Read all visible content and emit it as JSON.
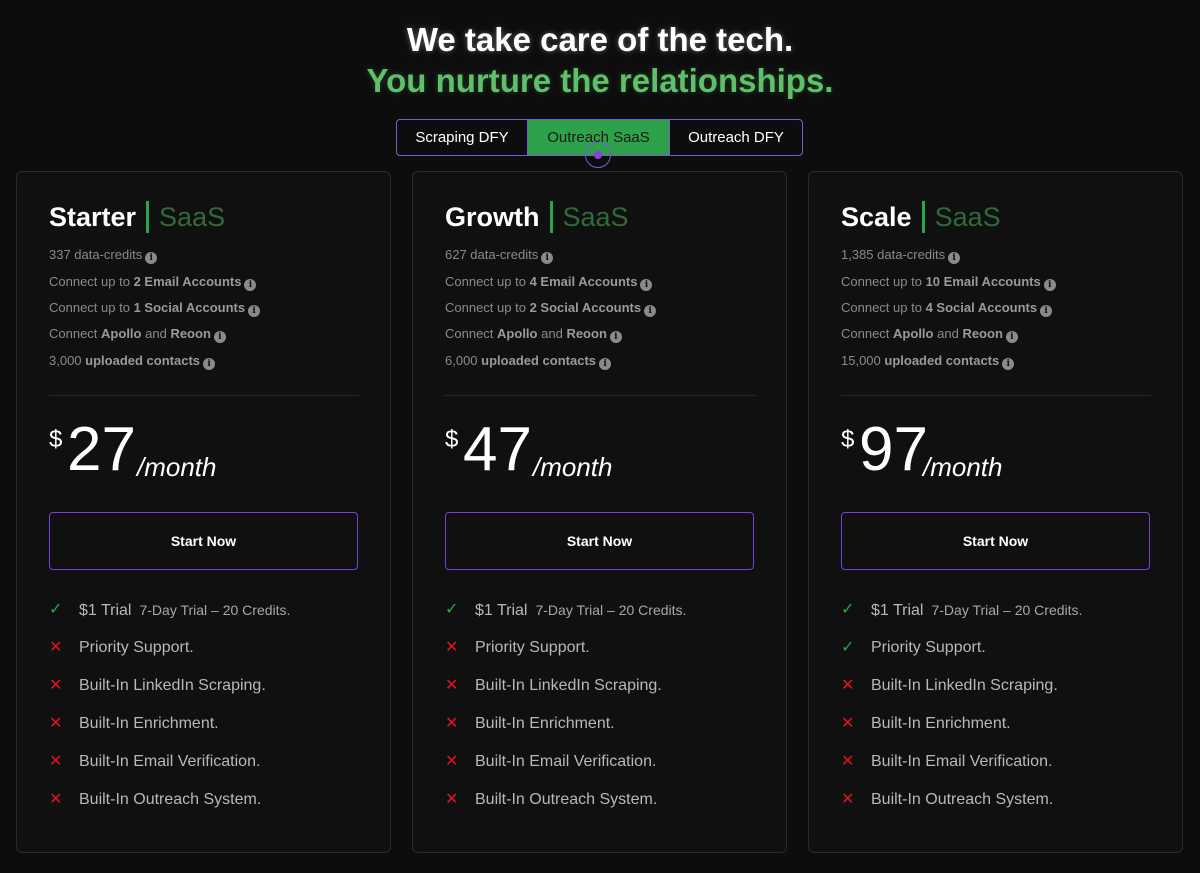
{
  "header": {
    "title": "We take care of the tech.",
    "subtitle": "You nurture the relationships."
  },
  "tabs": [
    {
      "label": "Scraping DFY",
      "active": false
    },
    {
      "label": "Outreach SaaS",
      "active": true
    },
    {
      "label": "Outreach DFY",
      "active": false
    }
  ],
  "colors": {
    "accent_green": "#2ea24a",
    "accent_purple": "#7b3fd9",
    "cross_red": "#e0141e"
  },
  "plans": [
    {
      "name": "Starter",
      "kind": "SaaS",
      "credits": "337 data-credits",
      "email_accounts": "2 Email Accounts",
      "social_accounts": "1 Social Accounts",
      "uploaded_contacts": "3,000",
      "currency": "$",
      "price": "27",
      "period": "/month",
      "cta": "Start Now",
      "trial_label": "$1 Trial",
      "trial_note": "7-Day Trial – 20 Credits.",
      "features": [
        {
          "label": "Priority Support.",
          "included": false
        },
        {
          "label": "Built-In LinkedIn Scraping.",
          "included": false
        },
        {
          "label": "Built-In Enrichment.",
          "included": false
        },
        {
          "label": "Built-In Email Verification.",
          "included": false
        },
        {
          "label": "Built-In Outreach System.",
          "included": false
        }
      ]
    },
    {
      "name": "Growth",
      "kind": "SaaS",
      "credits": "627 data-credits",
      "email_accounts": "4 Email Accounts",
      "social_accounts": "2 Social Accounts",
      "uploaded_contacts": "6,000",
      "currency": "$",
      "price": "47",
      "period": "/month",
      "cta": "Start Now",
      "trial_label": "$1 Trial",
      "trial_note": "7-Day Trial – 20 Credits.",
      "features": [
        {
          "label": "Priority Support.",
          "included": false
        },
        {
          "label": "Built-In LinkedIn Scraping.",
          "included": false
        },
        {
          "label": "Built-In Enrichment.",
          "included": false
        },
        {
          "label": "Built-In Email Verification.",
          "included": false
        },
        {
          "label": "Built-In Outreach System.",
          "included": false
        }
      ]
    },
    {
      "name": "Scale",
      "kind": "SaaS",
      "credits": "1,385 data-credits",
      "email_accounts": "10 Email Accounts",
      "social_accounts": "4 Social Accounts",
      "uploaded_contacts": "15,000",
      "currency": "$",
      "price": "97",
      "period": "/month",
      "cta": "Start Now",
      "trial_label": "$1 Trial",
      "trial_note": "7-Day Trial – 20 Credits.",
      "features": [
        {
          "label": "Priority Support.",
          "included": true
        },
        {
          "label": "Built-In LinkedIn Scraping.",
          "included": false
        },
        {
          "label": "Built-In Enrichment.",
          "included": false
        },
        {
          "label": "Built-In Email Verification.",
          "included": false
        },
        {
          "label": "Built-In Outreach System.",
          "included": false
        }
      ]
    }
  ],
  "common": {
    "connect_up_to": "Connect up to",
    "connect": "Connect",
    "apollo": "Apollo",
    "and": "and",
    "reoon": "Reoon",
    "uploaded_contacts_label": "uploaded contacts",
    "info_icon": "info-icon",
    "check_icon": "check-icon",
    "cross_icon": "cross-icon"
  }
}
